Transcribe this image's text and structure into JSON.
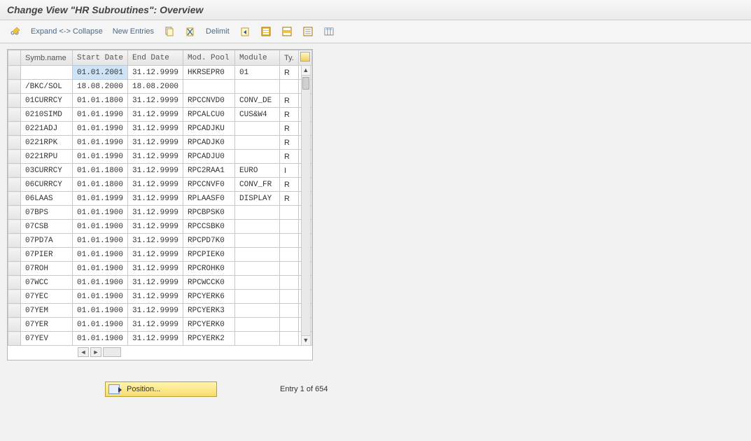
{
  "title": "Change View \"HR Subroutines\": Overview",
  "toolbar": {
    "expand": "Expand <-> Collapse",
    "new_entries": "New Entries",
    "delimit": "Delimit"
  },
  "columns": {
    "symb": "Symb.name",
    "start": "Start Date",
    "end": "End Date",
    "pool": "Mod. Pool",
    "module": "Module",
    "type": "Ty."
  },
  "rows": [
    {
      "symb": "",
      "start": "01.01.2001",
      "end": "31.12.9999",
      "pool": "HKRSEPR0",
      "module": "01",
      "type": "R",
      "sel": true
    },
    {
      "symb": "/BKC/SOL",
      "start": "18.08.2000",
      "end": "18.08.2000",
      "pool": "",
      "module": "",
      "type": ""
    },
    {
      "symb": "01CURRCY",
      "start": "01.01.1800",
      "end": "31.12.9999",
      "pool": "RPCCNVD0",
      "module": "CONV_DE",
      "type": "R"
    },
    {
      "symb": "0210SIMD",
      "start": "01.01.1990",
      "end": "31.12.9999",
      "pool": "RPCALCU0",
      "module": "CUS&W4",
      "type": "R"
    },
    {
      "symb": "0221ADJ",
      "start": "01.01.1990",
      "end": "31.12.9999",
      "pool": "RPCADJKU",
      "module": "",
      "type": "R"
    },
    {
      "symb": "0221RPK",
      "start": "01.01.1990",
      "end": "31.12.9999",
      "pool": "RPCADJK0",
      "module": "",
      "type": "R"
    },
    {
      "symb": "0221RPU",
      "start": "01.01.1990",
      "end": "31.12.9999",
      "pool": "RPCADJU0",
      "module": "",
      "type": "R"
    },
    {
      "symb": "03CURRCY",
      "start": "01.01.1800",
      "end": "31.12.9999",
      "pool": "RPC2RAA1",
      "module": "EURO",
      "type": "I"
    },
    {
      "symb": "06CURRCY",
      "start": "01.01.1800",
      "end": "31.12.9999",
      "pool": "RPCCNVF0",
      "module": "CONV_FR",
      "type": "R"
    },
    {
      "symb": "06LAAS",
      "start": "01.01.1999",
      "end": "31.12.9999",
      "pool": "RPLAASF0",
      "module": "DISPLAY",
      "type": "R"
    },
    {
      "symb": "07BPS",
      "start": "01.01.1900",
      "end": "31.12.9999",
      "pool": "RPCBPSK0",
      "module": "",
      "type": ""
    },
    {
      "symb": "07CSB",
      "start": "01.01.1900",
      "end": "31.12.9999",
      "pool": "RPCCSBK0",
      "module": "",
      "type": ""
    },
    {
      "symb": "07PD7A",
      "start": "01.01.1900",
      "end": "31.12.9999",
      "pool": "RPCPD7K0",
      "module": "",
      "type": ""
    },
    {
      "symb": "07PIER",
      "start": "01.01.1900",
      "end": "31.12.9999",
      "pool": "RPCPIEK0",
      "module": "",
      "type": ""
    },
    {
      "symb": "07ROH",
      "start": "01.01.1900",
      "end": "31.12.9999",
      "pool": "RPCROHK0",
      "module": "",
      "type": ""
    },
    {
      "symb": "07WCC",
      "start": "01.01.1900",
      "end": "31.12.9999",
      "pool": "RPCWCCK0",
      "module": "",
      "type": ""
    },
    {
      "symb": "07YEC",
      "start": "01.01.1900",
      "end": "31.12.9999",
      "pool": "RPCYERK6",
      "module": "",
      "type": ""
    },
    {
      "symb": "07YEM",
      "start": "01.01.1900",
      "end": "31.12.9999",
      "pool": "RPCYERK3",
      "module": "",
      "type": ""
    },
    {
      "symb": "07YER",
      "start": "01.01.1900",
      "end": "31.12.9999",
      "pool": "RPCYERK0",
      "module": "",
      "type": ""
    },
    {
      "symb": "07YEV",
      "start": "01.01.1900",
      "end": "31.12.9999",
      "pool": "RPCYERK2",
      "module": "",
      "type": ""
    }
  ],
  "footer": {
    "position": "Position...",
    "entry": "Entry 1 of 654"
  }
}
